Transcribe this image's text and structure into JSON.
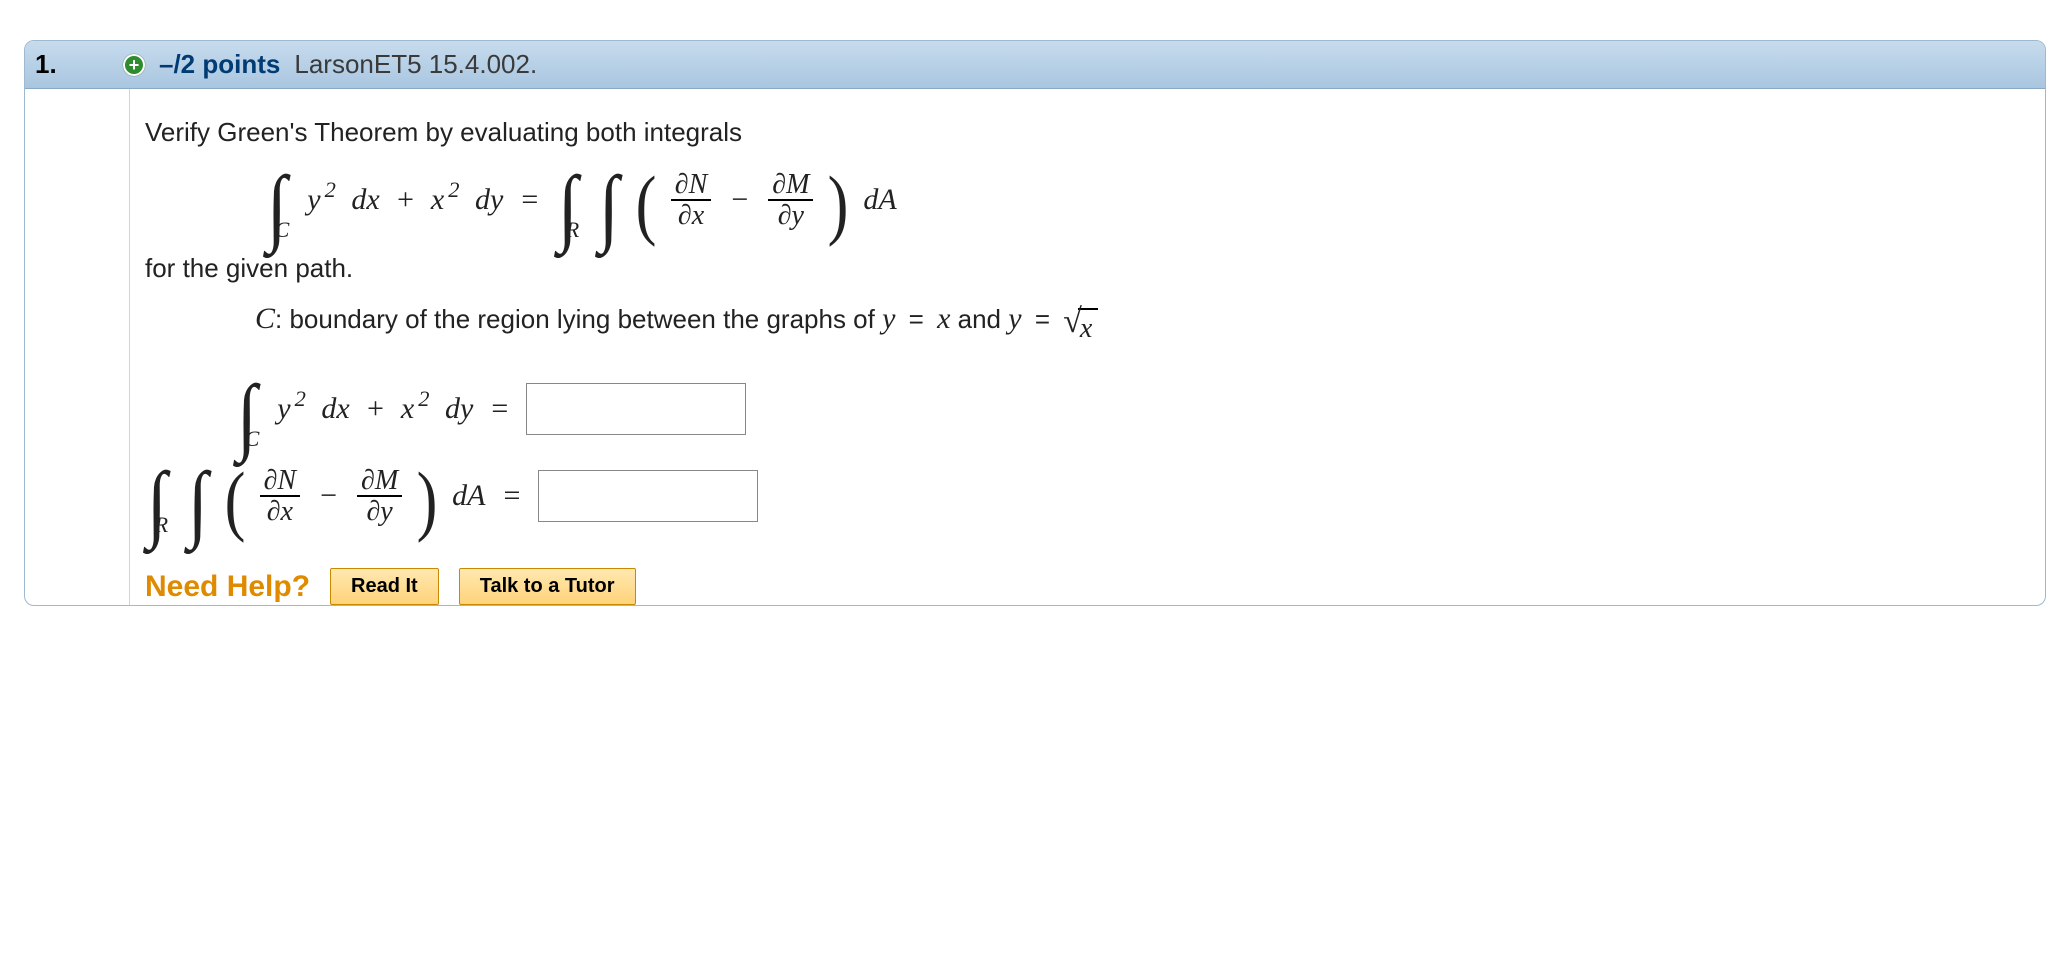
{
  "question": {
    "number": "1.",
    "plus_icon": "+",
    "points": "–/2 points",
    "source": "LarsonET5 15.4.002.",
    "prompt": "Verify Green's Theorem by evaluating both integrals",
    "for_path": "for the given path.",
    "path_label": "C",
    "path_text": ": boundary of the region lying between the graphs of ",
    "path_eq1_lhs": "y",
    "path_eq1_rhs": "x",
    "path_and": " and  ",
    "path_eq2_lhs": "y",
    "path_sqrt_arg": "x",
    "eq_sign": "="
  },
  "math": {
    "int_C": "C",
    "int_R": "R",
    "y": "y",
    "x": "x",
    "two": "2",
    "dx": "dx",
    "plus": "+",
    "dy": "dy",
    "dA": "dA",
    "dN": "∂N",
    "dM": "∂M",
    "dx_den": "∂x",
    "dy_den": "∂y",
    "minus": "−"
  },
  "help": {
    "label": "Need Help?",
    "read": "Read It",
    "tutor": "Talk to a Tutor"
  }
}
